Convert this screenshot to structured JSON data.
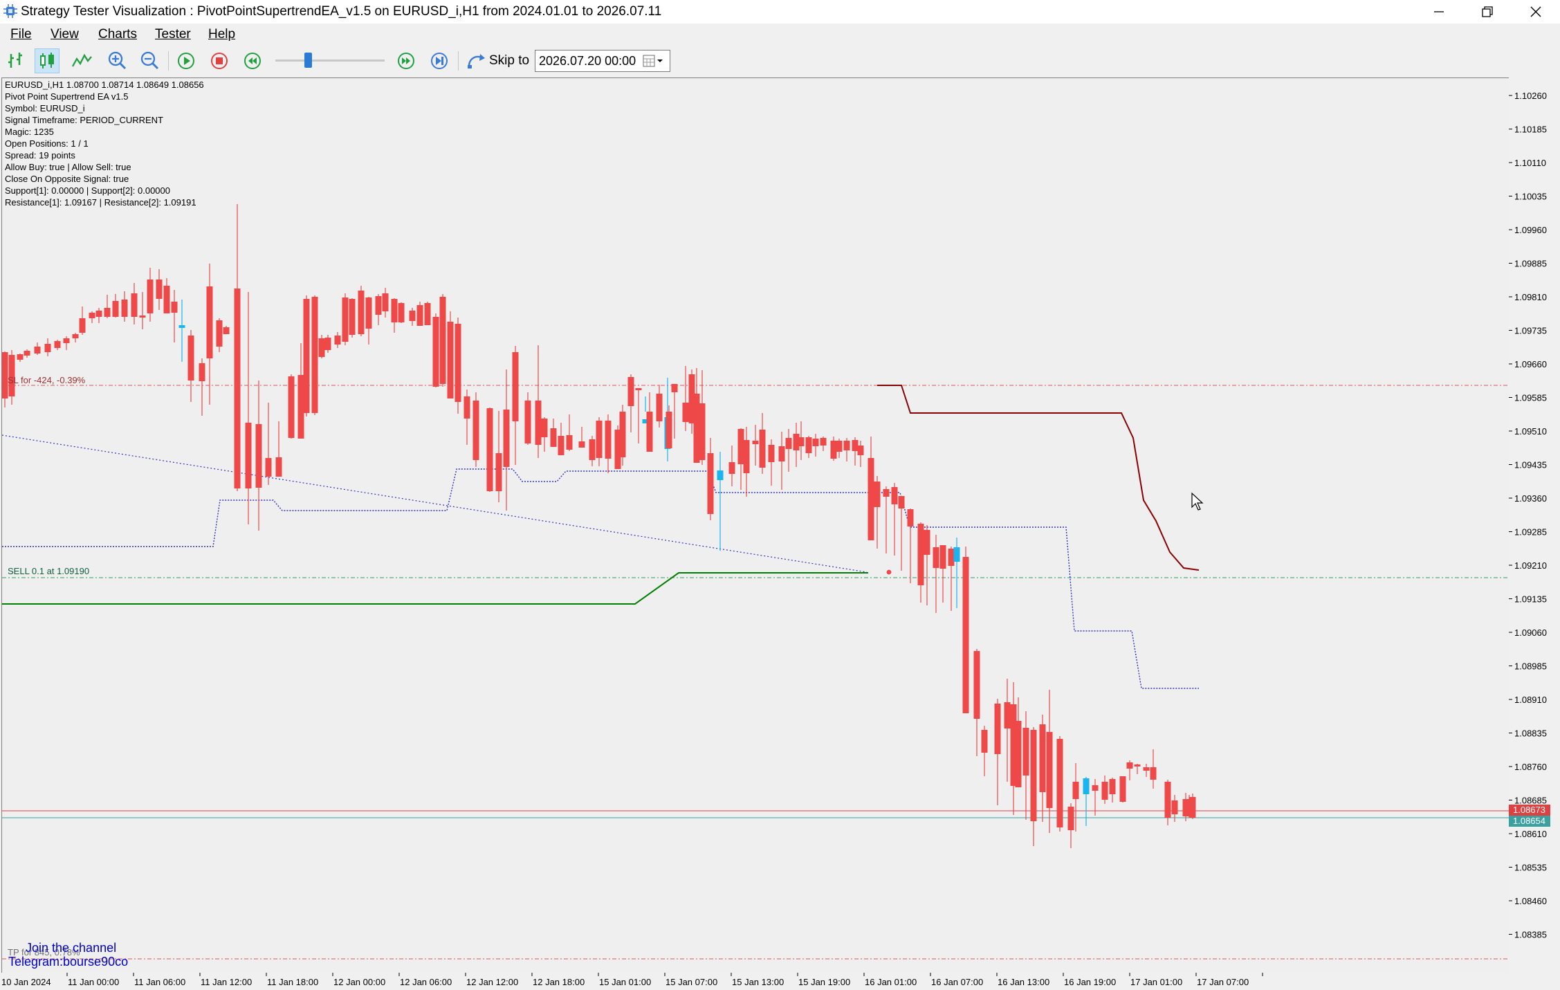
{
  "window": {
    "title": "Strategy Tester Visualization : PivotPointSupertrendEA_v1.5 on EURUSD_i,H1 from 2024.01.01 to 2026.07.11"
  },
  "menu": [
    {
      "label": "File"
    },
    {
      "label": "View"
    },
    {
      "label": "Charts"
    },
    {
      "label": "Tester"
    },
    {
      "label": "Help"
    }
  ],
  "toolbar": {
    "skip_to_label": "Skip to",
    "skip_to_value": "2026.07.20 00:00"
  },
  "chart": {
    "info_lines": [
      "EURUSD_i,H1  1.08700 1.08714 1.08649 1.08656",
      "Pivot Point Supertrend EA v1.5",
      "Symbol: EURUSD_i",
      "Signal Timeframe: PERIOD_CURRENT",
      "Magic: 1235",
      "Open Positions: 1 / 1",
      "Spread: 19 points",
      "Allow Buy: true | Allow Sell: true",
      "Close On Opposite Signal: true",
      "Support[1]: 0.00000 | Support[2]: 0.00000",
      "Resistance[1]: 1.09167 | Resistance[2]: 1.09191"
    ],
    "sl_label": "SL for -424, -0.39%",
    "order_label": "SELL 0.1 at 1.09190",
    "tp_label": "TP for 845, 0.78%",
    "telegram_lines": [
      "Join the channel",
      "Telegram:bourse90co"
    ],
    "price_ticks": [
      "1.10260",
      "1.10185",
      "1.10110",
      "1.10035",
      "1.09960",
      "1.09885",
      "1.09810",
      "1.09735",
      "1.09660",
      "1.09585",
      "1.09510",
      "1.09435",
      "1.09360",
      "1.09285",
      "1.09210",
      "1.09135",
      "1.09060",
      "1.08985",
      "1.08910",
      "1.08835",
      "1.08760",
      "1.08685",
      "1.08610",
      "1.08535",
      "1.08460",
      "1.08385"
    ],
    "bid_label": "1.08673",
    "ask_label": "1.08654",
    "time_ticks": [
      "10 Jan 2024",
      "11 Jan 00:00",
      "11 Jan 06:00",
      "11 Jan 12:00",
      "11 Jan 18:00",
      "12 Jan 00:00",
      "12 Jan 06:00",
      "12 Jan 12:00",
      "12 Jan 18:00",
      "15 Jan 01:00",
      "15 Jan 07:00",
      "15 Jan 13:00",
      "15 Jan 19:00",
      "16 Jan 01:00",
      "16 Jan 07:00",
      "16 Jan 13:00",
      "16 Jan 19:00",
      "17 Jan 01:00",
      "17 Jan 07:00"
    ],
    "colors": {
      "bull": "#1cb4ee",
      "bear": "#ef4848",
      "support_line": "#008000",
      "resistance_line": "#8b0000",
      "supertrend_dots": "#3030c8",
      "stop_loss_line": "#e05050",
      "order_line": "#2a9a6a",
      "telegram_text": "#0000cc"
    }
  }
}
